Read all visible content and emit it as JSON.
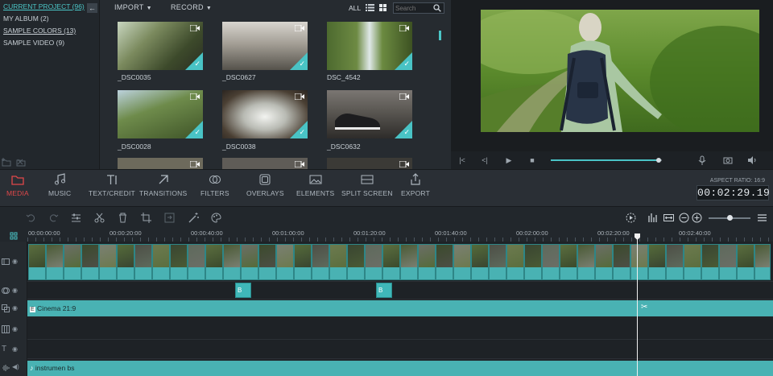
{
  "library": {
    "items": [
      {
        "label": "CURRENT PROJECT (96)"
      },
      {
        "label": "MY ALBUM (2)"
      },
      {
        "label": "SAMPLE COLORS (13)"
      },
      {
        "label": "SAMPLE VIDEO (9)"
      }
    ]
  },
  "browser": {
    "import_label": "IMPORT",
    "record_label": "RECORD",
    "filter_label": "ALL",
    "search_placeholder": "Search",
    "thumbs": [
      {
        "label": "_DSC0035"
      },
      {
        "label": "_DSC0627"
      },
      {
        "label": "DSC_4542"
      },
      {
        "label": "_DSC0028"
      },
      {
        "label": "_DSC0038"
      },
      {
        "label": "_DSC0632"
      }
    ]
  },
  "toolbar": {
    "tools": [
      {
        "label": "MEDIA",
        "icon": "folder-icon"
      },
      {
        "label": "MUSIC",
        "icon": "music-note-icon"
      },
      {
        "label": "TEXT/CREDIT",
        "icon": "text-icon"
      },
      {
        "label": "TRANSITIONS",
        "icon": "transitions-icon"
      },
      {
        "label": "FILTERS",
        "icon": "filters-icon"
      },
      {
        "label": "OVERLAYS",
        "icon": "overlays-icon"
      },
      {
        "label": "ELEMENTS",
        "icon": "image-icon"
      },
      {
        "label": "SPLIT SCREEN",
        "icon": "split-screen-icon"
      },
      {
        "label": "EXPORT",
        "icon": "export-icon"
      }
    ],
    "aspect_ratio": "ASPECT RATIO: 16:9",
    "timecode": "00:02:29.19"
  },
  "ruler": {
    "labels": [
      "00:00:00:00",
      "00:00:20:00",
      "00:00:40:00",
      "00:01:00:00",
      "00:01:20:00",
      "00:01:40:00",
      "00:02:00:00",
      "00:02:20:00",
      "00:02:40:00"
    ]
  },
  "tracks": {
    "fx_clips": [
      {
        "label": "B"
      },
      {
        "label": "B"
      }
    ],
    "text_clip": "Cinema 21:9",
    "audio_clip": "instrumen bs"
  },
  "colors": {
    "accent": "#49c3c5",
    "media_active": "#e0484a",
    "clip_teal": "#49b2b3"
  }
}
